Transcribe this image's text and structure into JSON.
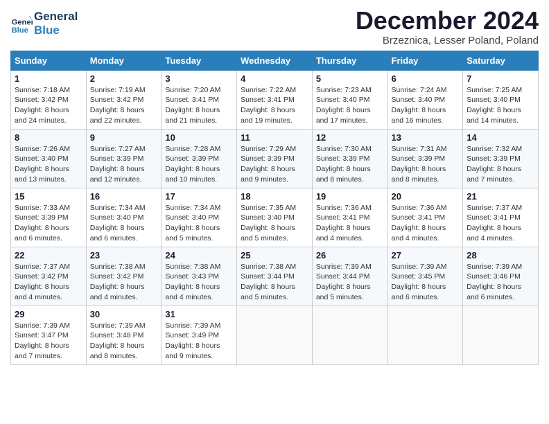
{
  "header": {
    "logo_line1": "General",
    "logo_line2": "Blue",
    "month_title": "December 2024",
    "location": "Brzeznica, Lesser Poland, Poland"
  },
  "columns": [
    "Sunday",
    "Monday",
    "Tuesday",
    "Wednesday",
    "Thursday",
    "Friday",
    "Saturday"
  ],
  "weeks": [
    [
      {
        "day": "1",
        "sunrise": "Sunrise: 7:18 AM",
        "sunset": "Sunset: 3:42 PM",
        "daylight": "Daylight: 8 hours and 24 minutes."
      },
      {
        "day": "2",
        "sunrise": "Sunrise: 7:19 AM",
        "sunset": "Sunset: 3:42 PM",
        "daylight": "Daylight: 8 hours and 22 minutes."
      },
      {
        "day": "3",
        "sunrise": "Sunrise: 7:20 AM",
        "sunset": "Sunset: 3:41 PM",
        "daylight": "Daylight: 8 hours and 21 minutes."
      },
      {
        "day": "4",
        "sunrise": "Sunrise: 7:22 AM",
        "sunset": "Sunset: 3:41 PM",
        "daylight": "Daylight: 8 hours and 19 minutes."
      },
      {
        "day": "5",
        "sunrise": "Sunrise: 7:23 AM",
        "sunset": "Sunset: 3:40 PM",
        "daylight": "Daylight: 8 hours and 17 minutes."
      },
      {
        "day": "6",
        "sunrise": "Sunrise: 7:24 AM",
        "sunset": "Sunset: 3:40 PM",
        "daylight": "Daylight: 8 hours and 16 minutes."
      },
      {
        "day": "7",
        "sunrise": "Sunrise: 7:25 AM",
        "sunset": "Sunset: 3:40 PM",
        "daylight": "Daylight: 8 hours and 14 minutes."
      }
    ],
    [
      {
        "day": "8",
        "sunrise": "Sunrise: 7:26 AM",
        "sunset": "Sunset: 3:40 PM",
        "daylight": "Daylight: 8 hours and 13 minutes."
      },
      {
        "day": "9",
        "sunrise": "Sunrise: 7:27 AM",
        "sunset": "Sunset: 3:39 PM",
        "daylight": "Daylight: 8 hours and 12 minutes."
      },
      {
        "day": "10",
        "sunrise": "Sunrise: 7:28 AM",
        "sunset": "Sunset: 3:39 PM",
        "daylight": "Daylight: 8 hours and 10 minutes."
      },
      {
        "day": "11",
        "sunrise": "Sunrise: 7:29 AM",
        "sunset": "Sunset: 3:39 PM",
        "daylight": "Daylight: 8 hours and 9 minutes."
      },
      {
        "day": "12",
        "sunrise": "Sunrise: 7:30 AM",
        "sunset": "Sunset: 3:39 PM",
        "daylight": "Daylight: 8 hours and 8 minutes."
      },
      {
        "day": "13",
        "sunrise": "Sunrise: 7:31 AM",
        "sunset": "Sunset: 3:39 PM",
        "daylight": "Daylight: 8 hours and 8 minutes."
      },
      {
        "day": "14",
        "sunrise": "Sunrise: 7:32 AM",
        "sunset": "Sunset: 3:39 PM",
        "daylight": "Daylight: 8 hours and 7 minutes."
      }
    ],
    [
      {
        "day": "15",
        "sunrise": "Sunrise: 7:33 AM",
        "sunset": "Sunset: 3:39 PM",
        "daylight": "Daylight: 8 hours and 6 minutes."
      },
      {
        "day": "16",
        "sunrise": "Sunrise: 7:34 AM",
        "sunset": "Sunset: 3:40 PM",
        "daylight": "Daylight: 8 hours and 6 minutes."
      },
      {
        "day": "17",
        "sunrise": "Sunrise: 7:34 AM",
        "sunset": "Sunset: 3:40 PM",
        "daylight": "Daylight: 8 hours and 5 minutes."
      },
      {
        "day": "18",
        "sunrise": "Sunrise: 7:35 AM",
        "sunset": "Sunset: 3:40 PM",
        "daylight": "Daylight: 8 hours and 5 minutes."
      },
      {
        "day": "19",
        "sunrise": "Sunrise: 7:36 AM",
        "sunset": "Sunset: 3:41 PM",
        "daylight": "Daylight: 8 hours and 4 minutes."
      },
      {
        "day": "20",
        "sunrise": "Sunrise: 7:36 AM",
        "sunset": "Sunset: 3:41 PM",
        "daylight": "Daylight: 8 hours and 4 minutes."
      },
      {
        "day": "21",
        "sunrise": "Sunrise: 7:37 AM",
        "sunset": "Sunset: 3:41 PM",
        "daylight": "Daylight: 8 hours and 4 minutes."
      }
    ],
    [
      {
        "day": "22",
        "sunrise": "Sunrise: 7:37 AM",
        "sunset": "Sunset: 3:42 PM",
        "daylight": "Daylight: 8 hours and 4 minutes."
      },
      {
        "day": "23",
        "sunrise": "Sunrise: 7:38 AM",
        "sunset": "Sunset: 3:42 PM",
        "daylight": "Daylight: 8 hours and 4 minutes."
      },
      {
        "day": "24",
        "sunrise": "Sunrise: 7:38 AM",
        "sunset": "Sunset: 3:43 PM",
        "daylight": "Daylight: 8 hours and 4 minutes."
      },
      {
        "day": "25",
        "sunrise": "Sunrise: 7:38 AM",
        "sunset": "Sunset: 3:44 PM",
        "daylight": "Daylight: 8 hours and 5 minutes."
      },
      {
        "day": "26",
        "sunrise": "Sunrise: 7:39 AM",
        "sunset": "Sunset: 3:44 PM",
        "daylight": "Daylight: 8 hours and 5 minutes."
      },
      {
        "day": "27",
        "sunrise": "Sunrise: 7:39 AM",
        "sunset": "Sunset: 3:45 PM",
        "daylight": "Daylight: 8 hours and 6 minutes."
      },
      {
        "day": "28",
        "sunrise": "Sunrise: 7:39 AM",
        "sunset": "Sunset: 3:46 PM",
        "daylight": "Daylight: 8 hours and 6 minutes."
      }
    ],
    [
      {
        "day": "29",
        "sunrise": "Sunrise: 7:39 AM",
        "sunset": "Sunset: 3:47 PM",
        "daylight": "Daylight: 8 hours and 7 minutes."
      },
      {
        "day": "30",
        "sunrise": "Sunrise: 7:39 AM",
        "sunset": "Sunset: 3:48 PM",
        "daylight": "Daylight: 8 hours and 8 minutes."
      },
      {
        "day": "31",
        "sunrise": "Sunrise: 7:39 AM",
        "sunset": "Sunset: 3:49 PM",
        "daylight": "Daylight: 8 hours and 9 minutes."
      },
      null,
      null,
      null,
      null
    ]
  ]
}
